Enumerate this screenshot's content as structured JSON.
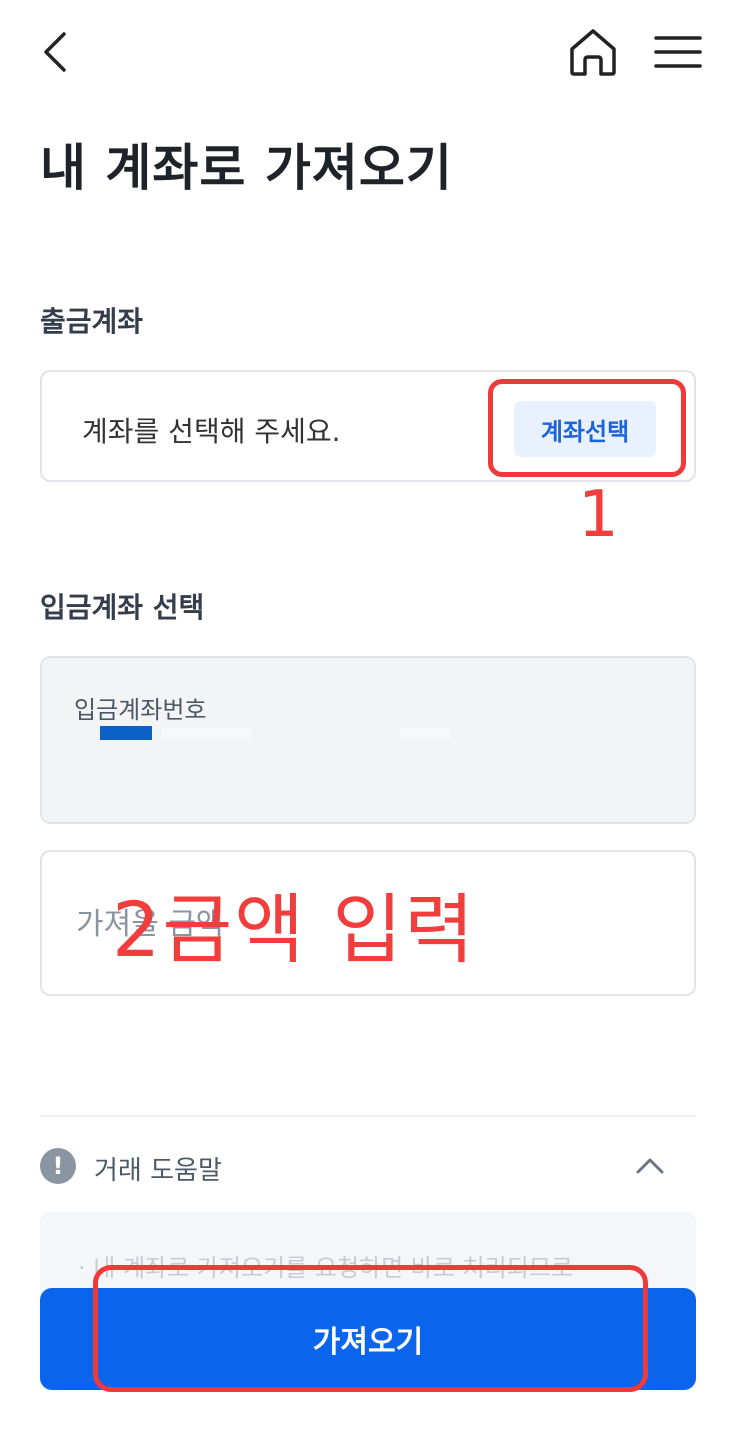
{
  "header": {
    "back_icon": "chevron-left-icon",
    "home_icon": "home-icon",
    "menu_icon": "hamburger-menu-icon"
  },
  "page_title": "내 계좌로 가져오기",
  "withdrawal": {
    "section_label": "출금계좌",
    "placeholder": "계좌를 선택해 주세요.",
    "select_button": "계좌선택"
  },
  "deposit": {
    "section_label": "입금계좌 선택",
    "field_label": "입금계좌번호"
  },
  "amount": {
    "placeholder": "가져올 금액"
  },
  "help": {
    "title": "거래 도움말",
    "icon": "exclamation-circle-icon",
    "toggle_icon": "chevron-up-icon",
    "bullet_text": "· 내 계좌로 가져오기를 요청하면 바로 처리되므로"
  },
  "submit_button": "가져오기",
  "annotations": {
    "step1": "1",
    "step2": "2금액 입력",
    "color": "#f03a3a"
  },
  "colors": {
    "primary": "#0b64ec",
    "select_btn_bg": "#e8f1fd",
    "select_btn_text": "#1b64da"
  }
}
